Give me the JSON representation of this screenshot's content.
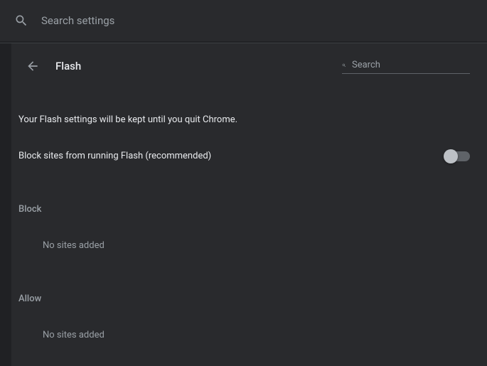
{
  "topSearch": {
    "placeholder": "Search settings"
  },
  "header": {
    "title": "Flash",
    "searchPlaceholder": "Search"
  },
  "info": "Your Flash settings will be kept until you quit Chrome.",
  "toggle": {
    "label": "Block sites from running Flash (recommended)",
    "enabled": false
  },
  "blockSection": {
    "title": "Block",
    "empty": "No sites added"
  },
  "allowSection": {
    "title": "Allow",
    "empty": "No sites added"
  }
}
